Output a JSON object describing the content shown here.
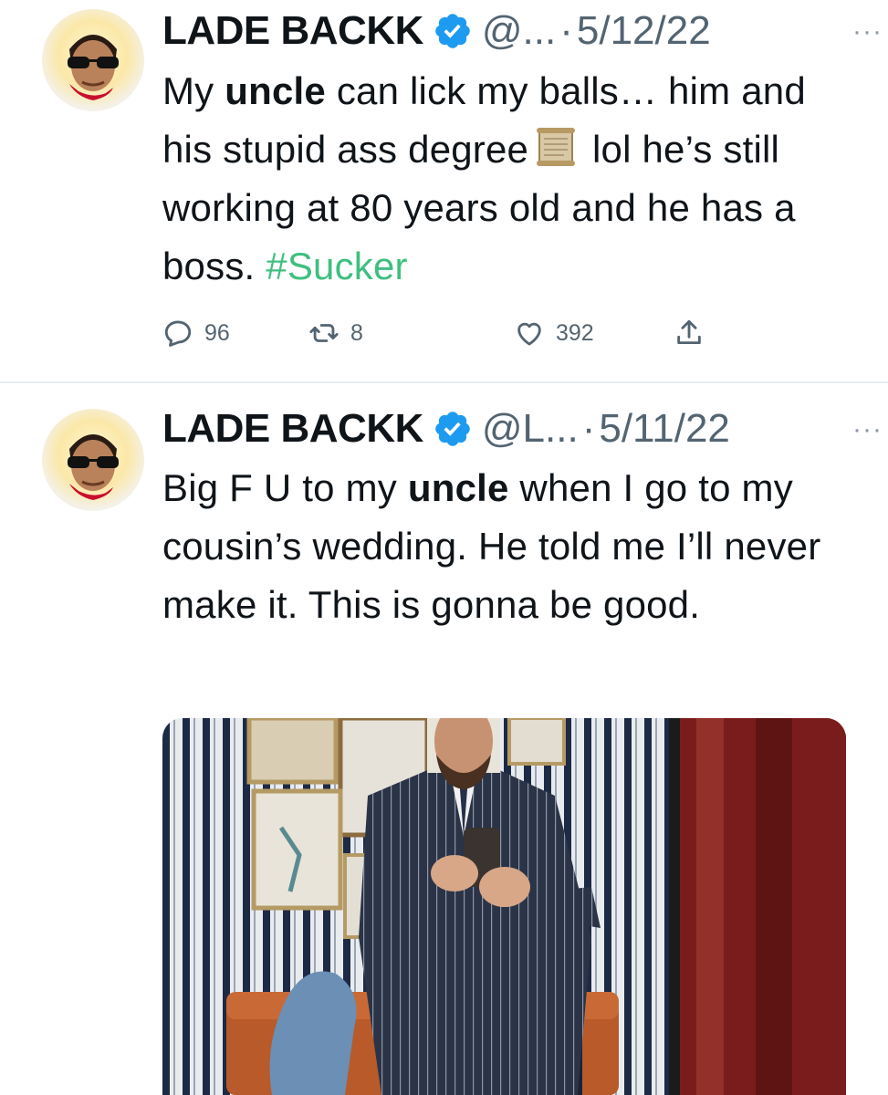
{
  "tweets": [
    {
      "author": "LADE BACKK",
      "handle": "@...",
      "date": "5/12/22",
      "more": "···",
      "text": {
        "part1": "My ",
        "bold1": "uncle",
        "part2": " can lick my balls… him and his stupid ass degree",
        "part3": " lol he’s still working at 80 years old and he has a boss. ",
        "hashtag": "#Sucker"
      },
      "stats": {
        "replies": "96",
        "retweets": "8",
        "likes": "392"
      }
    },
    {
      "author": "LADE BACKK",
      "handle": "@L...",
      "date": "5/11/22",
      "more": "···",
      "text": {
        "part1": "Big F U to my ",
        "bold1": "uncle",
        "part2": " when I go to my cousin’s wedding. He told me I’ll never make it. This is gonna be good."
      }
    }
  ],
  "separator": "·",
  "icons": [
    "verified-badge-icon",
    "reply-icon",
    "retweet-icon",
    "like-icon",
    "share-icon",
    "scroll-icon",
    "more-icon"
  ],
  "colors": {
    "verified": "#1d9bf0",
    "hashtag": "#3fbf7f",
    "secondary": "#536471"
  }
}
